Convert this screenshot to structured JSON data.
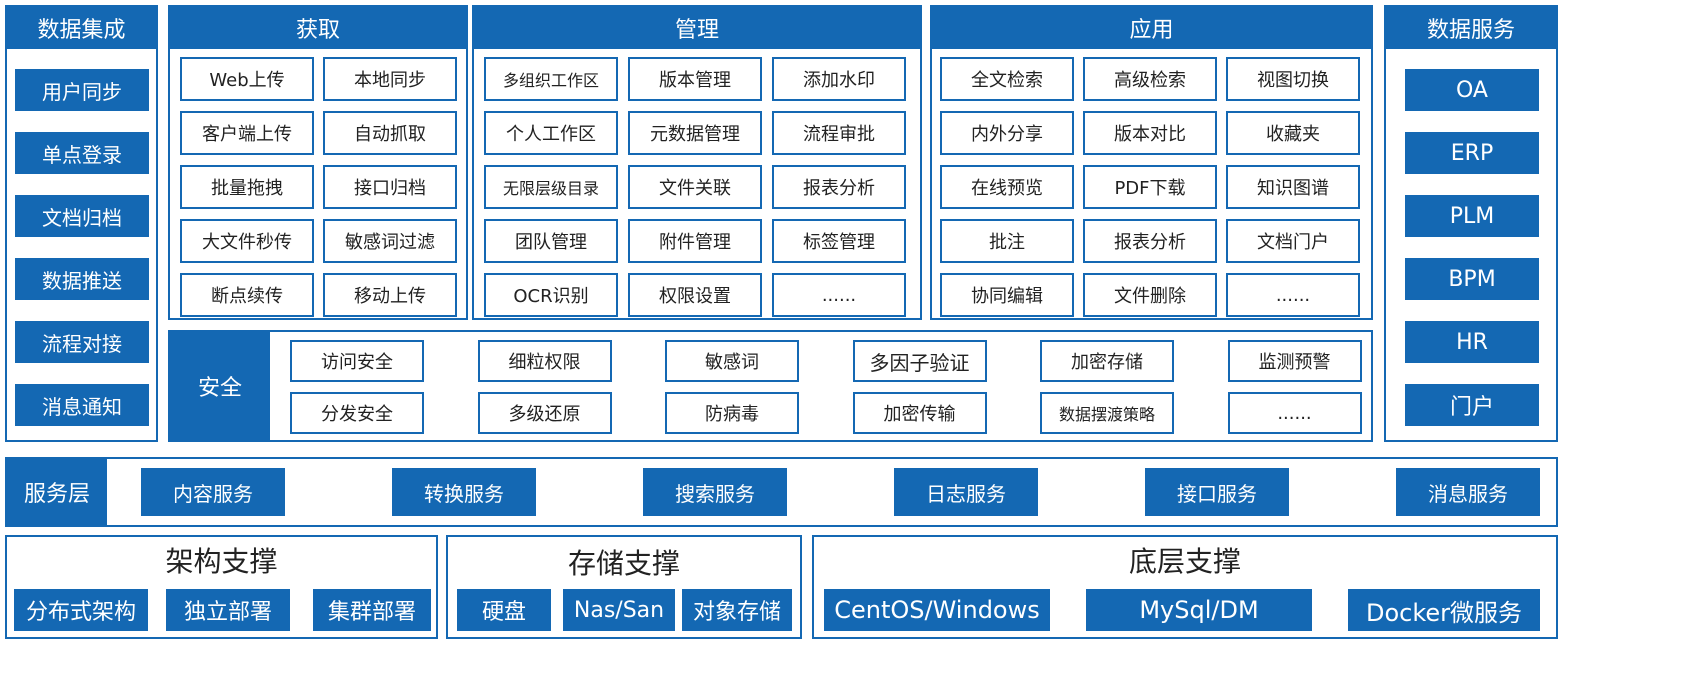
{
  "left": {
    "title": "数据集成",
    "items": [
      "用户同步",
      "单点登录",
      "文档归档",
      "数据推送",
      "流程对接",
      "消息通知"
    ]
  },
  "acquire": {
    "title": "获取",
    "items": [
      "Web上传",
      "本地同步",
      "客户端上传",
      "自动抓取",
      "批量拖拽",
      "接口归档",
      "大文件秒传",
      "敏感词过滤",
      "断点续传",
      "移动上传"
    ]
  },
  "manage": {
    "title": "管理",
    "items": [
      "多组织工作区",
      "版本管理",
      "添加水印",
      "个人工作区",
      "元数据管理",
      "流程审批",
      "无限层级目录",
      "文件关联",
      "报表分析",
      "团队管理",
      "附件管理",
      "标签管理",
      "OCR识别",
      "权限设置",
      "......"
    ]
  },
  "apply": {
    "title": "应用",
    "items": [
      "全文检索",
      "高级检索",
      "视图切换",
      "内外分享",
      "版本对比",
      "收藏夹",
      "在线预览",
      "PDF下载",
      "知识图谱",
      "批注",
      "报表分析",
      "文档门户",
      "协同编辑",
      "文件删除",
      "......"
    ]
  },
  "right": {
    "title": "数据服务",
    "items": [
      "OA",
      "ERP",
      "PLM",
      "BPM",
      "HR",
      "门户"
    ]
  },
  "security": {
    "title": "安全",
    "items": [
      "访问安全",
      "细粒权限",
      "敏感词",
      "多因子验证",
      "加密存储",
      "监测预警",
      "分发安全",
      "多级还原",
      "防病毒",
      "加密传输",
      "数据摆渡策略",
      "......"
    ]
  },
  "service": {
    "title": "服务层",
    "items": [
      "内容服务",
      "转换服务",
      "搜索服务",
      "日志服务",
      "接口服务",
      "消息服务"
    ]
  },
  "arch": {
    "title": "架构支撑",
    "items": [
      "分布式架构",
      "独立部署",
      "集群部署"
    ]
  },
  "storage": {
    "title": "存储支撑",
    "items": [
      "硬盘",
      "Nas/San",
      "对象存储"
    ]
  },
  "base": {
    "title": "底层支撑",
    "items": [
      "CentOS/Windows",
      "MySql/DM",
      "Docker微服务"
    ]
  },
  "colors": {
    "primary": "#1468b3",
    "background": "#ffffff"
  }
}
